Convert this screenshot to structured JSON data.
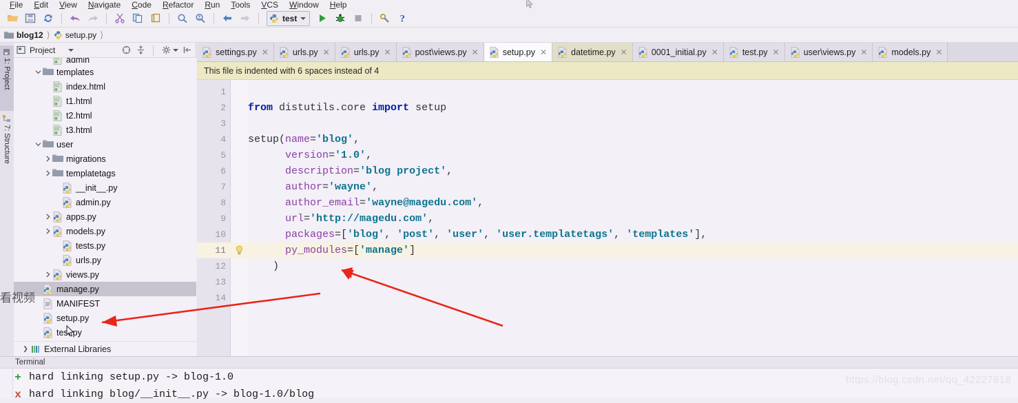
{
  "menu": {
    "items": [
      "File",
      "Edit",
      "View",
      "Navigate",
      "Code",
      "Refactor",
      "Run",
      "Tools",
      "VCS",
      "Window",
      "Help"
    ]
  },
  "toolbar": {
    "icons": [
      "open-folder-icon",
      "save-all-icon",
      "sync-icon",
      "undo-icon",
      "redo-icon",
      "cut-icon",
      "copy-icon",
      "paste-icon",
      "find-icon",
      "find-usages-icon",
      "back-icon",
      "forward-icon"
    ],
    "run_config": "test",
    "run_label": "Run",
    "debug_label": "Debug",
    "stop_label": "Stop",
    "settings_label": "Settings",
    "help_label": "Help"
  },
  "breadcrumb": {
    "project": "blog12",
    "file": "setup.py"
  },
  "rail": {
    "tabs": [
      {
        "label": "1: Project",
        "selected": true
      },
      {
        "label": "7: Structure",
        "selected": false
      }
    ]
  },
  "project_panel": {
    "title": "Project",
    "header_icons": [
      "collapse-all-icon",
      "expand-all-icon",
      "gear-icon",
      "hide-icon"
    ],
    "tree": [
      {
        "label": "admin",
        "icon": "html-file-icon",
        "indent": 3,
        "arrow": "",
        "clipped": true,
        "selected": false
      },
      {
        "label": "templates",
        "icon": "folder-icon",
        "indent": 2,
        "arrow": "down",
        "selected": false
      },
      {
        "label": "index.html",
        "icon": "html-file-icon",
        "indent": 3,
        "arrow": "",
        "selected": false
      },
      {
        "label": "t1.html",
        "icon": "html-file-icon",
        "indent": 3,
        "arrow": "",
        "selected": false
      },
      {
        "label": "t2.html",
        "icon": "html-file-icon",
        "indent": 3,
        "arrow": "",
        "selected": false
      },
      {
        "label": "t3.html",
        "icon": "html-file-icon",
        "indent": 3,
        "arrow": "",
        "selected": false
      },
      {
        "label": "user",
        "icon": "folder-icon",
        "indent": 2,
        "arrow": "down",
        "selected": false
      },
      {
        "label": "migrations",
        "icon": "folder-icon",
        "indent": 3,
        "arrow": "right",
        "selected": false
      },
      {
        "label": "templatetags",
        "icon": "folder-icon",
        "indent": 3,
        "arrow": "right",
        "selected": false
      },
      {
        "label": "__init__.py",
        "icon": "py-file-icon",
        "indent": 4,
        "arrow": "",
        "selected": false
      },
      {
        "label": "admin.py",
        "icon": "py-file-icon",
        "indent": 4,
        "arrow": "",
        "selected": false
      },
      {
        "label": "apps.py",
        "icon": "py-file-icon",
        "indent": 3,
        "arrow": "right",
        "selected": false
      },
      {
        "label": "models.py",
        "icon": "py-file-icon",
        "indent": 3,
        "arrow": "right",
        "selected": false
      },
      {
        "label": "tests.py",
        "icon": "py-file-icon",
        "indent": 4,
        "arrow": "",
        "selected": false
      },
      {
        "label": "urls.py",
        "icon": "py-file-icon",
        "indent": 4,
        "arrow": "",
        "selected": false
      },
      {
        "label": "views.py",
        "icon": "py-file-icon",
        "indent": 3,
        "arrow": "right",
        "selected": false
      },
      {
        "label": "manage.py",
        "icon": "py-file-icon",
        "indent": 2,
        "arrow": "",
        "selected": true
      },
      {
        "label": "MANIFEST",
        "icon": "text-file-icon",
        "indent": 2,
        "arrow": "",
        "selected": false
      },
      {
        "label": "setup.py",
        "icon": "py-file-icon",
        "indent": 2,
        "arrow": "",
        "selected": false
      },
      {
        "label": "test.py",
        "icon": "py-file-icon",
        "indent": 2,
        "arrow": "",
        "selected": false
      }
    ],
    "external_libraries": "External Libraries"
  },
  "editor": {
    "tabs": [
      {
        "label": "settings.py",
        "active": false,
        "olive": false
      },
      {
        "label": "urls.py",
        "active": false,
        "olive": false
      },
      {
        "label": "urls.py",
        "active": false,
        "olive": false
      },
      {
        "label": "post\\views.py",
        "active": false,
        "olive": false
      },
      {
        "label": "setup.py",
        "active": true,
        "olive": false
      },
      {
        "label": "datetime.py",
        "active": false,
        "olive": true
      },
      {
        "label": "0001_initial.py",
        "active": false,
        "olive": false
      },
      {
        "label": "test.py",
        "active": false,
        "olive": false
      },
      {
        "label": "user\\views.py",
        "active": false,
        "olive": false
      },
      {
        "label": "models.py",
        "active": false,
        "olive": false
      }
    ],
    "notification": "This file is indented with 6 spaces instead of 4",
    "highlighted_line": 11,
    "bulb_line": 11,
    "line_numbers": [
      1,
      2,
      3,
      4,
      5,
      6,
      7,
      8,
      9,
      10,
      11,
      12,
      13,
      14
    ],
    "code_lines": [
      {
        "n": 1,
        "tokens": []
      },
      {
        "n": 2,
        "tokens": [
          {
            "t": "from ",
            "c": "kw"
          },
          {
            "t": "distutils.core ",
            "c": "id"
          },
          {
            "t": "import ",
            "c": "kw"
          },
          {
            "t": "setup",
            "c": "id"
          }
        ]
      },
      {
        "n": 3,
        "tokens": []
      },
      {
        "n": 4,
        "tokens": [
          {
            "t": "setup(",
            "c": "id"
          },
          {
            "t": "name",
            "c": "kwarg"
          },
          {
            "t": "=",
            "c": "pn"
          },
          {
            "t": "'blog'",
            "c": "str"
          },
          {
            "t": ",",
            "c": "pn"
          }
        ]
      },
      {
        "n": 5,
        "tokens": [
          {
            "t": "      ",
            "c": "pn"
          },
          {
            "t": "version",
            "c": "kwarg"
          },
          {
            "t": "=",
            "c": "pn"
          },
          {
            "t": "'1.0'",
            "c": "str"
          },
          {
            "t": ",",
            "c": "pn"
          }
        ]
      },
      {
        "n": 6,
        "tokens": [
          {
            "t": "      ",
            "c": "pn"
          },
          {
            "t": "description",
            "c": "kwarg"
          },
          {
            "t": "=",
            "c": "pn"
          },
          {
            "t": "'blog project'",
            "c": "str"
          },
          {
            "t": ",",
            "c": "pn"
          }
        ]
      },
      {
        "n": 7,
        "tokens": [
          {
            "t": "      ",
            "c": "pn"
          },
          {
            "t": "author",
            "c": "kwarg"
          },
          {
            "t": "=",
            "c": "pn"
          },
          {
            "t": "'wayne'",
            "c": "str"
          },
          {
            "t": ",",
            "c": "pn"
          }
        ]
      },
      {
        "n": 8,
        "tokens": [
          {
            "t": "      ",
            "c": "pn"
          },
          {
            "t": "author_email",
            "c": "kwarg"
          },
          {
            "t": "=",
            "c": "pn"
          },
          {
            "t": "'wayne@magedu.com'",
            "c": "str"
          },
          {
            "t": ",",
            "c": "pn"
          }
        ]
      },
      {
        "n": 9,
        "tokens": [
          {
            "t": "      ",
            "c": "pn"
          },
          {
            "t": "url",
            "c": "kwarg"
          },
          {
            "t": "=",
            "c": "pn"
          },
          {
            "t": "'http://magedu.com'",
            "c": "str"
          },
          {
            "t": ",",
            "c": "pn"
          }
        ]
      },
      {
        "n": 10,
        "tokens": [
          {
            "t": "      ",
            "c": "pn"
          },
          {
            "t": "packages",
            "c": "kwarg"
          },
          {
            "t": "=[",
            "c": "pn"
          },
          {
            "t": "'blog'",
            "c": "str"
          },
          {
            "t": ", ",
            "c": "pn"
          },
          {
            "t": "'post'",
            "c": "str"
          },
          {
            "t": ", ",
            "c": "pn"
          },
          {
            "t": "'user'",
            "c": "str"
          },
          {
            "t": ", ",
            "c": "pn"
          },
          {
            "t": "'user.templatetags'",
            "c": "str"
          },
          {
            "t": ", ",
            "c": "pn"
          },
          {
            "t": "'templates'",
            "c": "str"
          },
          {
            "t": "],",
            "c": "pn"
          }
        ]
      },
      {
        "n": 11,
        "tokens": [
          {
            "t": "      ",
            "c": "pn"
          },
          {
            "t": "py_modules",
            "c": "kwarg"
          },
          {
            "t": "=[",
            "c": "pn"
          },
          {
            "t": "'manage'",
            "c": "str"
          },
          {
            "t": "]",
            "c": "pn"
          }
        ]
      },
      {
        "n": 12,
        "tokens": [
          {
            "t": "    )",
            "c": "pn"
          }
        ]
      },
      {
        "n": 13,
        "tokens": []
      },
      {
        "n": 14,
        "tokens": []
      }
    ]
  },
  "terminal": {
    "title": "Terminal",
    "lines": [
      {
        "mark": "+",
        "mark_type": "plus",
        "text": "hard linking setup.py -> blog-1.0"
      },
      {
        "mark": "x",
        "mark_type": "cross",
        "text": "hard linking blog/__init__.py -> blog-1.0/blog"
      }
    ]
  },
  "overlays": {
    "cjk_text": "看视频",
    "watermark": "https://blog.csdn.net/qq_42227818"
  },
  "colors": {
    "keyword": "#00209f",
    "string": "#0e7490",
    "kwarg": "#8b3ea8",
    "notification_bg": "#ece9c4",
    "highlight_line": "#f7f2e1",
    "selection": "#c8c4cf",
    "arrow_red": "#e8261a",
    "run_green": "#2e9e3e"
  }
}
